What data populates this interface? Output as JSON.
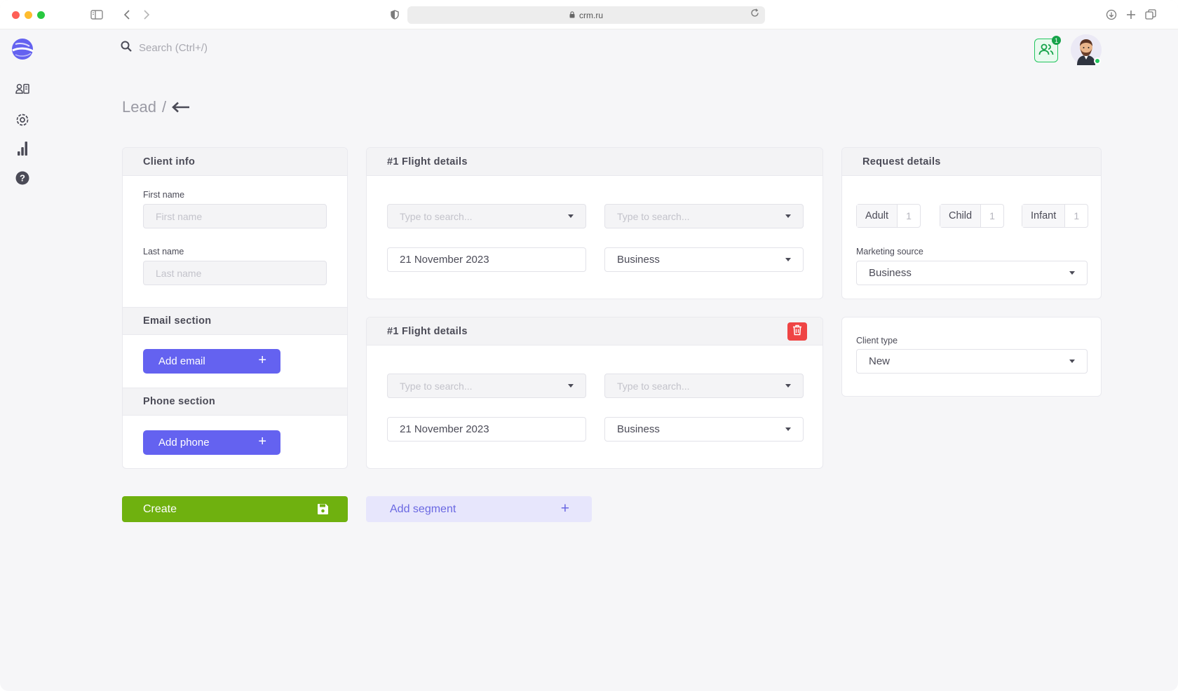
{
  "browser": {
    "url": "crm.ru"
  },
  "search": {
    "placeholder": "Search (Ctrl+/)"
  },
  "header": {
    "notification_count": "1"
  },
  "breadcrumb": {
    "root": "Lead",
    "separator": "/"
  },
  "client_info": {
    "title": "Client info",
    "first_name_label": "First name",
    "first_name_placeholder": "First name",
    "last_name_label": "Last name",
    "last_name_placeholder": "Last name",
    "email_section_title": "Email section",
    "add_email_label": "Add email",
    "phone_section_title": "Phone section",
    "add_phone_label": "Add phone"
  },
  "flights": [
    {
      "title": "#1 Flight details",
      "from_placeholder": "Type to search...",
      "to_placeholder": "Type to search...",
      "date": "21 November 2023",
      "class": "Business"
    },
    {
      "title": "#1 Flight details",
      "from_placeholder": "Type to search...",
      "to_placeholder": "Type to search...",
      "date": "21 November 2023",
      "class": "Business"
    }
  ],
  "request_details": {
    "title": "Request details",
    "passengers": [
      {
        "label": "Adult",
        "count": "1"
      },
      {
        "label": "Child",
        "count": "1"
      },
      {
        "label": "Infant",
        "count": "1"
      }
    ],
    "marketing_source_label": "Marketing source",
    "marketing_source_value": "Business"
  },
  "client_type": {
    "label": "Client type",
    "value": "New"
  },
  "actions": {
    "create_label": "Create",
    "add_segment_label": "Add segment"
  },
  "colors": {
    "primary": "#6462f0",
    "create": "#6fb10f",
    "danger": "#ef4444",
    "success": "#22c55e"
  },
  "icons": [
    "sidebar-toggle-icon",
    "back-icon",
    "forward-icon",
    "shield-icon",
    "lock-icon",
    "reload-icon",
    "download-icon",
    "new-tab-icon",
    "tabs-icon",
    "logo-icon",
    "contacts-icon",
    "settings-icon",
    "analytics-icon",
    "help-icon",
    "search-icon",
    "team-icon",
    "arrow-left-icon",
    "plus-icon",
    "trash-icon",
    "save-icon"
  ]
}
